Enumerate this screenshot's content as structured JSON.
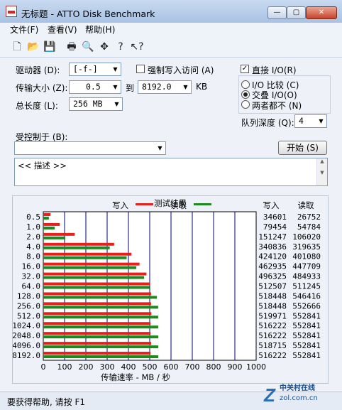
{
  "window": {
    "title": "无标题 - ATTO Disk Benchmark",
    "min": "—",
    "max": "▢",
    "close": "✕"
  },
  "menu": [
    "文件(F)",
    "查看(V)",
    "帮助(H)"
  ],
  "toolbar": [
    "new-file-icon",
    "open-folder-icon",
    "save-icon",
    "print-icon",
    "print-preview-icon",
    "move-icon",
    "help-icon",
    "context-help-icon"
  ],
  "form": {
    "drive_label": "驱动器 (D):",
    "drive_value": "[-f-]",
    "force_write_label": "强制写入访问 (A)",
    "force_write_checked": false,
    "direct_io_label": "直接 I/O(R)",
    "direct_io_checked": true,
    "transfer_label": "传输大小 (Z):",
    "transfer_from": "0.5",
    "to_label": "到",
    "transfer_to": "8192.0",
    "kb_label": "KB",
    "total_label": "总长度 (L):",
    "total_value": "256 MB",
    "io_compare_label": "I/O 比较 (C)",
    "overlap_io_label": "交叠 I/O(O)",
    "neither_label": "两者都不 (N)",
    "selected_mode": "overlap",
    "queue_label": "队列深度 (Q):",
    "queue_value": "4",
    "controlled_by_label": "受控制于 (B):",
    "controlled_by_value": "",
    "start_label": "开始 (S)",
    "description": "<< 描述 >>"
  },
  "results": {
    "title": "测试结果",
    "write_legend": "写入",
    "read_legend": "读取",
    "write_col": "写入",
    "read_col": "读取",
    "xlabel": "传输速率 - MB / 秒"
  },
  "chart_data": {
    "type": "bar",
    "title": "测试结果",
    "xlabel": "传输速率 - MB / 秒",
    "xlim": [
      0,
      1000
    ],
    "xticks": [
      0,
      100,
      200,
      300,
      400,
      500,
      600,
      700,
      800,
      900,
      1000
    ],
    "categories": [
      "0.5",
      "1.0",
      "2.0",
      "4.0",
      "8.0",
      "16.0",
      "32.0",
      "64.0",
      "128.0",
      "256.0",
      "512.0",
      "1024.0",
      "2048.0",
      "4096.0",
      "8192.0"
    ],
    "series": [
      {
        "name": "写入",
        "color": "#e8201c",
        "values": [
          34601,
          79454,
          151247,
          340836,
          424120,
          462935,
          496325,
          512507,
          518448,
          518448,
          519971,
          516222,
          516222,
          518715,
          516222
        ]
      },
      {
        "name": "读取",
        "color": "#1c8a1c",
        "values": [
          26752,
          54784,
          106020,
          319635,
          401080,
          447709,
          484933,
          511245,
          546416,
          552666,
          552841,
          552841,
          552841,
          552841,
          552841
        ]
      }
    ]
  },
  "status": {
    "text": "要获得帮助, 请按 F1"
  },
  "watermark": {
    "brand": "中关村在线",
    "url": "zol.com.cn"
  }
}
